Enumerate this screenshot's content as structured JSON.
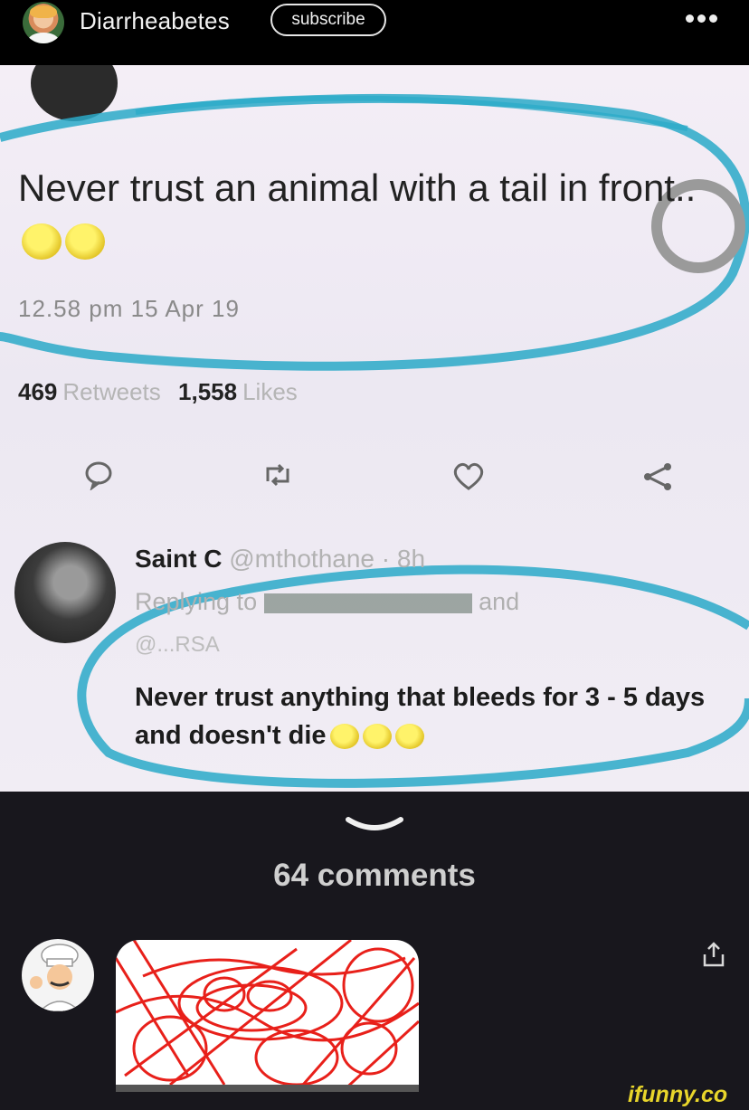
{
  "header": {
    "channel_name": "Diarrheabetes",
    "subscribe_label": "subscribe"
  },
  "meme": {
    "tweet_text": "Never trust an animal with a tail in front..",
    "tweet_time": "12.58 pm  15 Apr 19",
    "retweets_count": "469",
    "retweets_label": "Retweets",
    "likes_count": "1,558",
    "likes_label": "Likes",
    "reply_name": "Saint C",
    "reply_handle": "@mthothane · 8h",
    "reply_to_prefix": "Replying to",
    "reply_to_suffix": "and",
    "reply_to_handle2": "@...RSA",
    "reply_text": "Never trust anything that bleeds for 3 - 5 days and doesn't die",
    "annotation_color": "#2aa9c8"
  },
  "comments": {
    "count_label": "64 comments"
  },
  "watermark": "ifunny.co"
}
